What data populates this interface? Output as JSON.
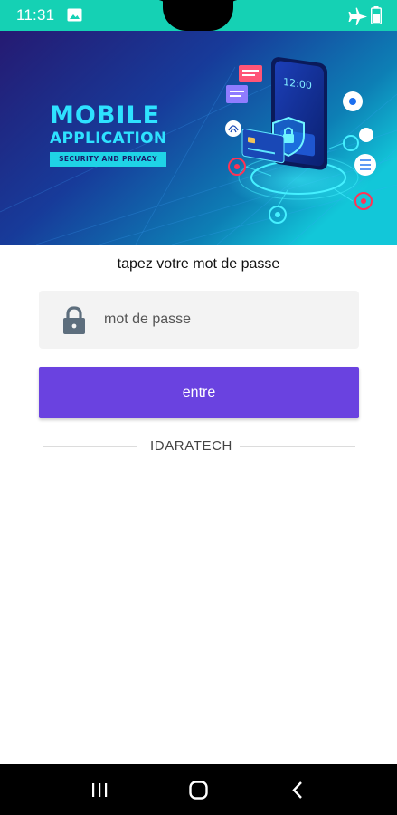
{
  "status_bar": {
    "time": "11:31",
    "color": "#15d1b4"
  },
  "banner": {
    "title_line1": "MOBILE",
    "title_line2": "APPLICATION",
    "subtitle": "SECURITY AND PRIVACY",
    "phone_clock": "12:00"
  },
  "login": {
    "prompt": "tapez votre mot de passe",
    "password_placeholder": "mot de passe",
    "submit_label": "entre",
    "accent_color": "#6a42e0"
  },
  "footer": {
    "brand": "IDARATECH"
  },
  "icons": [
    "gallery-icon",
    "airplane-icon",
    "battery-icon",
    "lock-icon",
    "recents-icon",
    "home-icon",
    "back-icon"
  ]
}
